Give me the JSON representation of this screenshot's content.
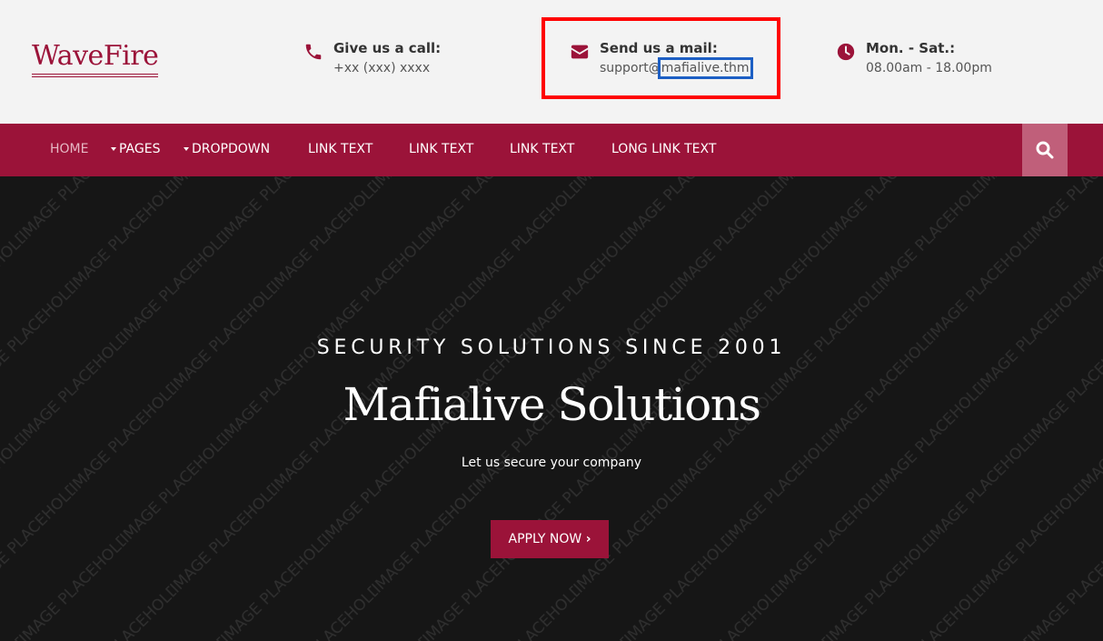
{
  "brand": {
    "logo_text": "WaveFire",
    "accent_color": "#9b1339"
  },
  "contact": {
    "call": {
      "title": "Give us a call:",
      "value": "+xx (xxx) xxxx",
      "icon": "phone-icon"
    },
    "mail": {
      "title": "Send us a mail:",
      "value_prefix": "support@",
      "value_highlight": "mafialive.thm",
      "icon": "envelope-icon"
    },
    "hours": {
      "title": "Mon. - Sat.:",
      "value": "08.00am - 18.00pm",
      "icon": "clock-icon"
    }
  },
  "nav": {
    "items": [
      {
        "label": "HOME",
        "active": true,
        "dropdown": false
      },
      {
        "label": "PAGES",
        "active": false,
        "dropdown": true
      },
      {
        "label": "DROPDOWN",
        "active": false,
        "dropdown": true
      },
      {
        "label": "LINK TEXT",
        "active": false,
        "dropdown": false
      },
      {
        "label": "LINK TEXT",
        "active": false,
        "dropdown": false
      },
      {
        "label": "LINK TEXT",
        "active": false,
        "dropdown": false
      },
      {
        "label": "LONG LINK TEXT",
        "active": false,
        "dropdown": false
      }
    ],
    "search_icon": "search-icon"
  },
  "hero": {
    "watermark": "IMAGE PLACEHOLDER",
    "kicker": "SECURITY SOLUTIONS SINCE 2001",
    "headline": "Mafialive Solutions",
    "subtitle": "Let us secure your company",
    "cta_label": "APPLY NOW",
    "cta_icon": "chevron-right-icon"
  }
}
